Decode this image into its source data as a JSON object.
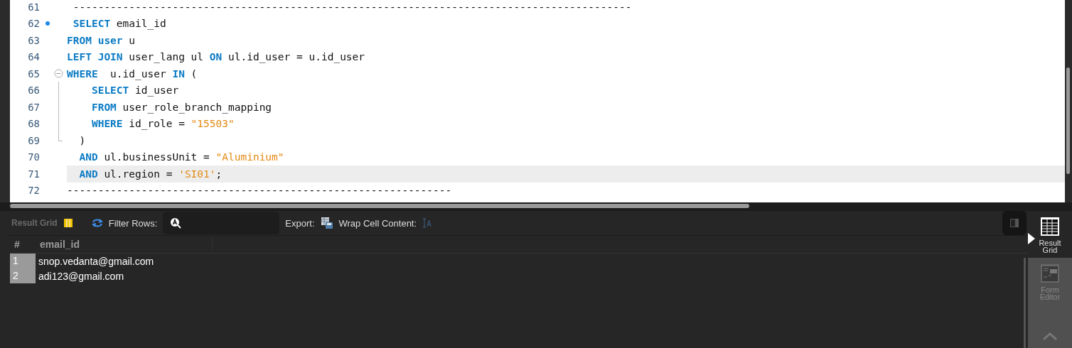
{
  "editor": {
    "lines": [
      {
        "number": "61",
        "current": false,
        "bookmark": false,
        "fold_open": false,
        "fold_body": false,
        "fold_end": false,
        "tokens": [
          {
            "kind": "plain",
            "text": " ------------------------------------------------------------------------------------------"
          }
        ]
      },
      {
        "number": "62",
        "current": false,
        "bookmark": true,
        "fold_open": false,
        "fold_body": false,
        "fold_end": false,
        "tokens": [
          {
            "kind": "keyword",
            "text": " SELECT"
          },
          {
            "kind": "plain",
            "text": " email_id"
          }
        ]
      },
      {
        "number": "63",
        "current": false,
        "bookmark": false,
        "fold_open": false,
        "fold_body": false,
        "fold_end": false,
        "tokens": [
          {
            "kind": "keyword",
            "text": "FROM user"
          },
          {
            "kind": "plain",
            "text": " u"
          }
        ]
      },
      {
        "number": "64",
        "current": false,
        "bookmark": false,
        "fold_open": false,
        "fold_body": false,
        "fold_end": false,
        "tokens": [
          {
            "kind": "keyword",
            "text": "LEFT JOIN"
          },
          {
            "kind": "plain",
            "text": " user_lang ul "
          },
          {
            "kind": "keyword",
            "text": "ON"
          },
          {
            "kind": "plain",
            "text": " ul.id_user = u.id_user"
          }
        ]
      },
      {
        "number": "65",
        "current": false,
        "bookmark": false,
        "fold_open": true,
        "fold_body": false,
        "fold_end": false,
        "tokens": [
          {
            "kind": "keyword",
            "text": "WHERE"
          },
          {
            "kind": "plain",
            "text": "  u.id_user "
          },
          {
            "kind": "keyword",
            "text": "IN"
          },
          {
            "kind": "plain",
            "text": " ("
          }
        ]
      },
      {
        "number": "66",
        "current": false,
        "bookmark": false,
        "fold_open": false,
        "fold_body": true,
        "fold_end": false,
        "tokens": [
          {
            "kind": "keyword",
            "text": "    SELECT"
          },
          {
            "kind": "plain",
            "text": " id_user"
          }
        ]
      },
      {
        "number": "67",
        "current": false,
        "bookmark": false,
        "fold_open": false,
        "fold_body": true,
        "fold_end": false,
        "tokens": [
          {
            "kind": "keyword",
            "text": "    FROM"
          },
          {
            "kind": "plain",
            "text": " user_role_branch_mapping"
          }
        ]
      },
      {
        "number": "68",
        "current": false,
        "bookmark": false,
        "fold_open": false,
        "fold_body": true,
        "fold_end": false,
        "tokens": [
          {
            "kind": "keyword",
            "text": "    WHERE"
          },
          {
            "kind": "plain",
            "text": " id_role = "
          },
          {
            "kind": "string",
            "text": "\"15503\""
          }
        ]
      },
      {
        "number": "69",
        "current": false,
        "bookmark": false,
        "fold_open": false,
        "fold_body": false,
        "fold_end": true,
        "tokens": [
          {
            "kind": "plain",
            "text": "  )"
          }
        ]
      },
      {
        "number": "70",
        "current": false,
        "bookmark": false,
        "fold_open": false,
        "fold_body": false,
        "fold_end": false,
        "tokens": [
          {
            "kind": "keyword",
            "text": "  AND"
          },
          {
            "kind": "plain",
            "text": " ul.businessUnit = "
          },
          {
            "kind": "string",
            "text": "\"Aluminium\""
          }
        ]
      },
      {
        "number": "71",
        "current": true,
        "bookmark": false,
        "fold_open": false,
        "fold_body": false,
        "fold_end": false,
        "tokens": [
          {
            "kind": "keyword",
            "text": "  AND"
          },
          {
            "kind": "plain",
            "text": " ul.region = "
          },
          {
            "kind": "string",
            "text": "'SI01'"
          },
          {
            "kind": "plain",
            "text": ";"
          }
        ]
      },
      {
        "number": "72",
        "current": false,
        "bookmark": false,
        "fold_open": false,
        "fold_body": false,
        "fold_end": false,
        "tokens": [
          {
            "kind": "plain",
            "text": "--------------------------------------------------------------"
          }
        ]
      }
    ]
  },
  "toolbar": {
    "result_grid_label": "Result Grid",
    "filter_label": "Filter Rows:",
    "export_label": "Export:",
    "wrap_label": "Wrap Cell Content:"
  },
  "table": {
    "columns": [
      "#",
      "email_id"
    ],
    "rows": [
      {
        "number": "1",
        "email_id": "snop.vedanta@gmail.com"
      },
      {
        "number": "2",
        "email_id": "adi123@gmail.com"
      }
    ]
  },
  "side_tabs": [
    {
      "label": "Result Grid",
      "kind": "grid",
      "selected": true
    },
    {
      "label": "Form Editor",
      "kind": "form",
      "selected": false
    }
  ]
}
